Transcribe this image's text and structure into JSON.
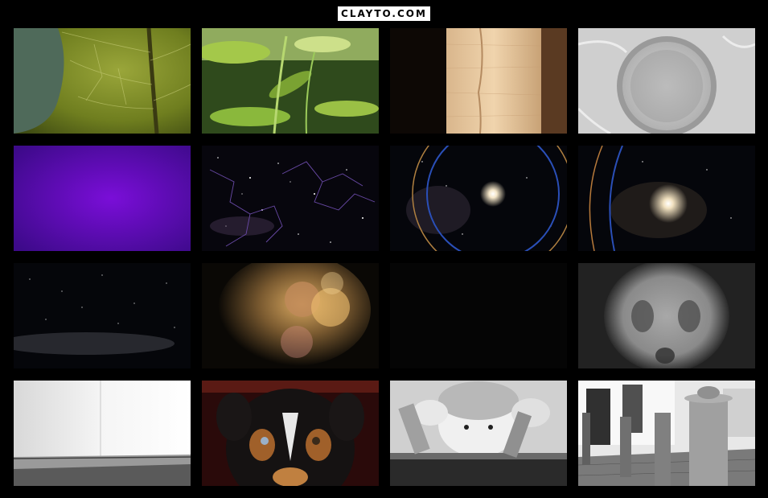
{
  "header": {
    "logo_text": "CLAYTO.COM"
  },
  "gallery": {
    "thumbnails": [
      {
        "icon": "leaf-closeup-thumbnail"
      },
      {
        "icon": "green-plants-thumbnail"
      },
      {
        "icon": "paper-lantern-thumbnail"
      },
      {
        "icon": "fabric-seal-thumbnail"
      },
      {
        "icon": "purple-gradient-thumbnail"
      },
      {
        "icon": "constellation-lines-thumbnail"
      },
      {
        "icon": "star-circle-orbit-thumbnail"
      },
      {
        "icon": "bright-star-arcs-thumbnail"
      },
      {
        "icon": "milky-way-thumbnail"
      },
      {
        "icon": "bokeh-face-thumbnail"
      },
      {
        "icon": "black-frame-thumbnail"
      },
      {
        "icon": "blurry-face-thumbnail"
      },
      {
        "icon": "white-interior-thumbnail"
      },
      {
        "icon": "dog-portrait-thumbnail"
      },
      {
        "icon": "child-peeking-thumbnail"
      },
      {
        "icon": "street-bollards-thumbnail"
      }
    ]
  }
}
